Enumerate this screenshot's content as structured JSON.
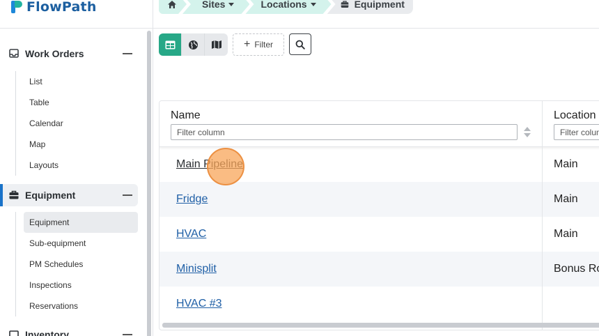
{
  "app": {
    "name": "FlowPath"
  },
  "breadcrumb": [
    {
      "label": "",
      "icon": "home-icon"
    },
    {
      "label": "Sites"
    },
    {
      "label": "Locations"
    },
    {
      "label": "Equipment",
      "icon": "toolbox-icon"
    }
  ],
  "sidebar": {
    "sections": [
      {
        "label": "Work Orders",
        "icon": "inbox-icon",
        "items": [
          "List",
          "Table",
          "Calendar",
          "Map",
          "Layouts"
        ]
      },
      {
        "label": "Equipment",
        "icon": "toolbox-icon",
        "active": true,
        "items": [
          "Equipment",
          "Sub-equipment",
          "PM Schedules",
          "Inspections",
          "Reservations"
        ],
        "active_item": "Equipment"
      },
      {
        "label": "Inventory",
        "icon": "inventory-icon"
      }
    ]
  },
  "toolbar": {
    "views": [
      "table-view-icon",
      "globe-view-icon",
      "map-view-icon"
    ],
    "active_view": "table-view-icon",
    "filter_label": "Filter"
  },
  "table": {
    "columns": [
      {
        "label": "Name",
        "filter_placeholder": "Filter column"
      },
      {
        "label": "Location",
        "filter_placeholder": "Filter column"
      }
    ],
    "rows": [
      {
        "name": "Main Pipeline",
        "location": "Main"
      },
      {
        "name": "Fridge",
        "location": "Main"
      },
      {
        "name": "HVAC",
        "location": "Main"
      },
      {
        "name": "Minisplit",
        "location": "Bonus Ro"
      },
      {
        "name": "HVAC #3",
        "location": ""
      }
    ]
  },
  "colors": {
    "accent": "#27a887",
    "breadcrumb_bg": "#d4f3ec",
    "link": "#1f5fa6",
    "active_bar": "#1a73c9"
  }
}
